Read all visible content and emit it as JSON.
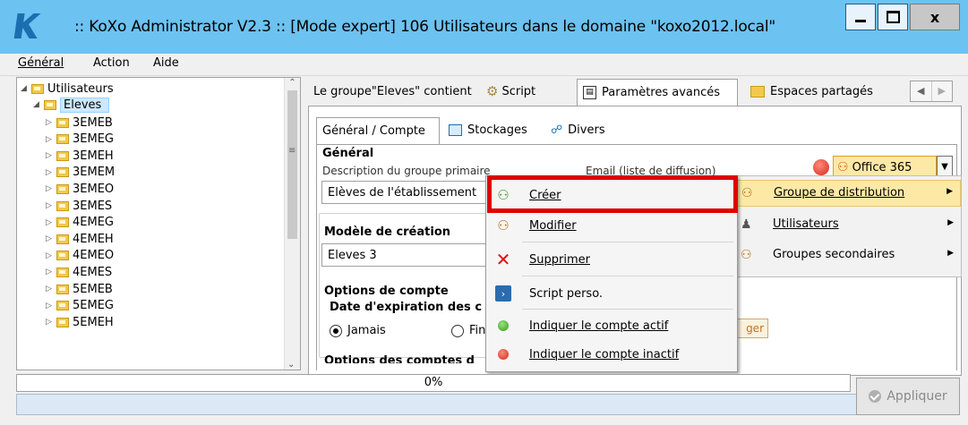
{
  "window": {
    "title": ":: KoXo Administrator V2.3 :: [Mode expert] 106 Utilisateurs dans le domaine \"koxo2012.local\"",
    "minimize_glyph": "−",
    "maximize_glyph": "□",
    "close_glyph": "x"
  },
  "menu": {
    "general": "Général",
    "action": "Action",
    "aide": "Aide"
  },
  "tree": {
    "root": "Utilisateurs",
    "selected": "Eleves",
    "children": [
      "3EMEB",
      "3EMEG",
      "3EMEH",
      "3EMEM",
      "3EMEO",
      "3EMES",
      "4EMEG",
      "4EMEH",
      "4EMEO",
      "4EMES",
      "5EMEB",
      "5EMEG",
      "5EMEH"
    ]
  },
  "top_tabs": {
    "group_contains": "Le groupe\"Eleves\" contient",
    "script": "Script",
    "advanced": "Paramètres avancés",
    "shared": "Espaces partagés"
  },
  "sub_tabs": {
    "general_account": "Général / Compte",
    "storages": "Stockages",
    "misc": "Divers"
  },
  "form": {
    "section_general": "Général",
    "desc_label": "Description du groupe primaire",
    "desc_value": "Elèves de l'établissement",
    "email_label": "Email (liste de diffusion)",
    "office_label": "Office 365",
    "model_heading": "Modèle de création",
    "model_value": "Eleves 3",
    "account_options": "Options de compte",
    "expiration_label": "Date d'expiration des c",
    "never": "Jamais",
    "end_partial": "Fin",
    "change_partial": "ger",
    "more_options_partial": "Options des comptes d"
  },
  "context_menu": {
    "items": [
      "Créer",
      "Modifier",
      "Supprimer",
      "Script perso.",
      "Indiquer le compte actif",
      "Indiquer le compte inactif"
    ]
  },
  "submenu": {
    "items": [
      "Groupe de distribution",
      "Utilisateurs",
      "Groupes secondaires"
    ]
  },
  "progress": {
    "label": "0%",
    "value": 0
  },
  "apply_button": "Appliquer",
  "colors": {
    "titlebar": "#6cc2f0",
    "selection": "#cce8ff",
    "highlight_box": "#e00000",
    "status": "#dbe8f5"
  }
}
